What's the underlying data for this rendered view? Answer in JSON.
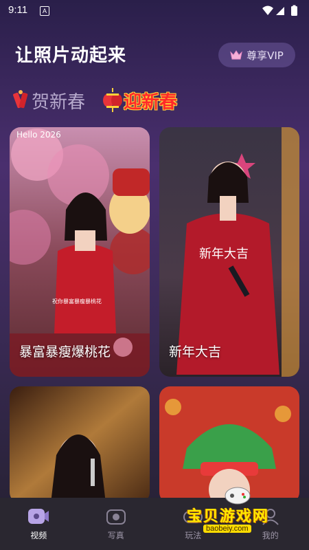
{
  "status": {
    "time": "9:11",
    "notif": "A"
  },
  "header": {
    "title": "让照片动起来",
    "vip_label": "尊享VIP"
  },
  "tabs": [
    {
      "label": "贺新春"
    },
    {
      "label": "迎新春"
    }
  ],
  "cards": [
    {
      "label": "暴富暴瘦爆桃花",
      "caption": "祝你暴富暴瘦暴桃花",
      "banner": "Hello 2026"
    },
    {
      "label": "新年大吉",
      "caption": "新年大吉"
    },
    {
      "label": ""
    },
    {
      "label": ""
    }
  ],
  "nav": [
    {
      "label": "视频"
    },
    {
      "label": "写真"
    },
    {
      "label": "玩法"
    },
    {
      "label": "我的"
    }
  ],
  "watermark": {
    "title": "宝贝游戏网",
    "url": "baobeiy.com"
  },
  "colors": {
    "accent_red": "#ff2a2a",
    "vip_bg": "#6f5a9a",
    "nav_bg": "#2a2730"
  }
}
